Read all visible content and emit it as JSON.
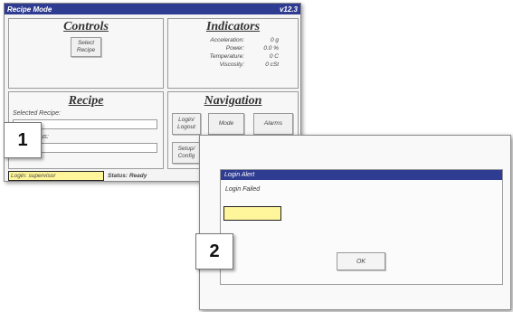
{
  "window1": {
    "title": "Recipe Mode",
    "version": "v12.3",
    "controls": {
      "heading": "Controls",
      "select_recipe_label": "Select Recipe"
    },
    "indicators": {
      "heading": "Indicators",
      "rows": [
        {
          "label": "Acceleration:",
          "value": "0 g"
        },
        {
          "label": "Power:",
          "value": "0.0 %"
        },
        {
          "label": "Temperature:",
          "value": "0 C"
        },
        {
          "label": "Viscosity:",
          "value": "0 cSt"
        }
      ]
    },
    "recipe": {
      "heading": "Recipe",
      "selected_label": "Selected Recipe:",
      "status_label": "Status:"
    },
    "navigation": {
      "heading": "Navigation",
      "login_logout_label": "Login/ Logout",
      "mode_label": "Mode",
      "alarms_label": "Alarms",
      "setup_config_label": "Setup/ Config"
    },
    "statusbar": {
      "login_text": "Login: supervisor",
      "status_text": "Status: Ready"
    }
  },
  "window2": {
    "dialog_title": "Login Alert",
    "message": "Login Failed",
    "ok_label": "OK"
  },
  "callouts": {
    "one": "1",
    "two": "2"
  },
  "colors": {
    "titlebar": "#2e3c92",
    "highlight": "#fff59a"
  }
}
